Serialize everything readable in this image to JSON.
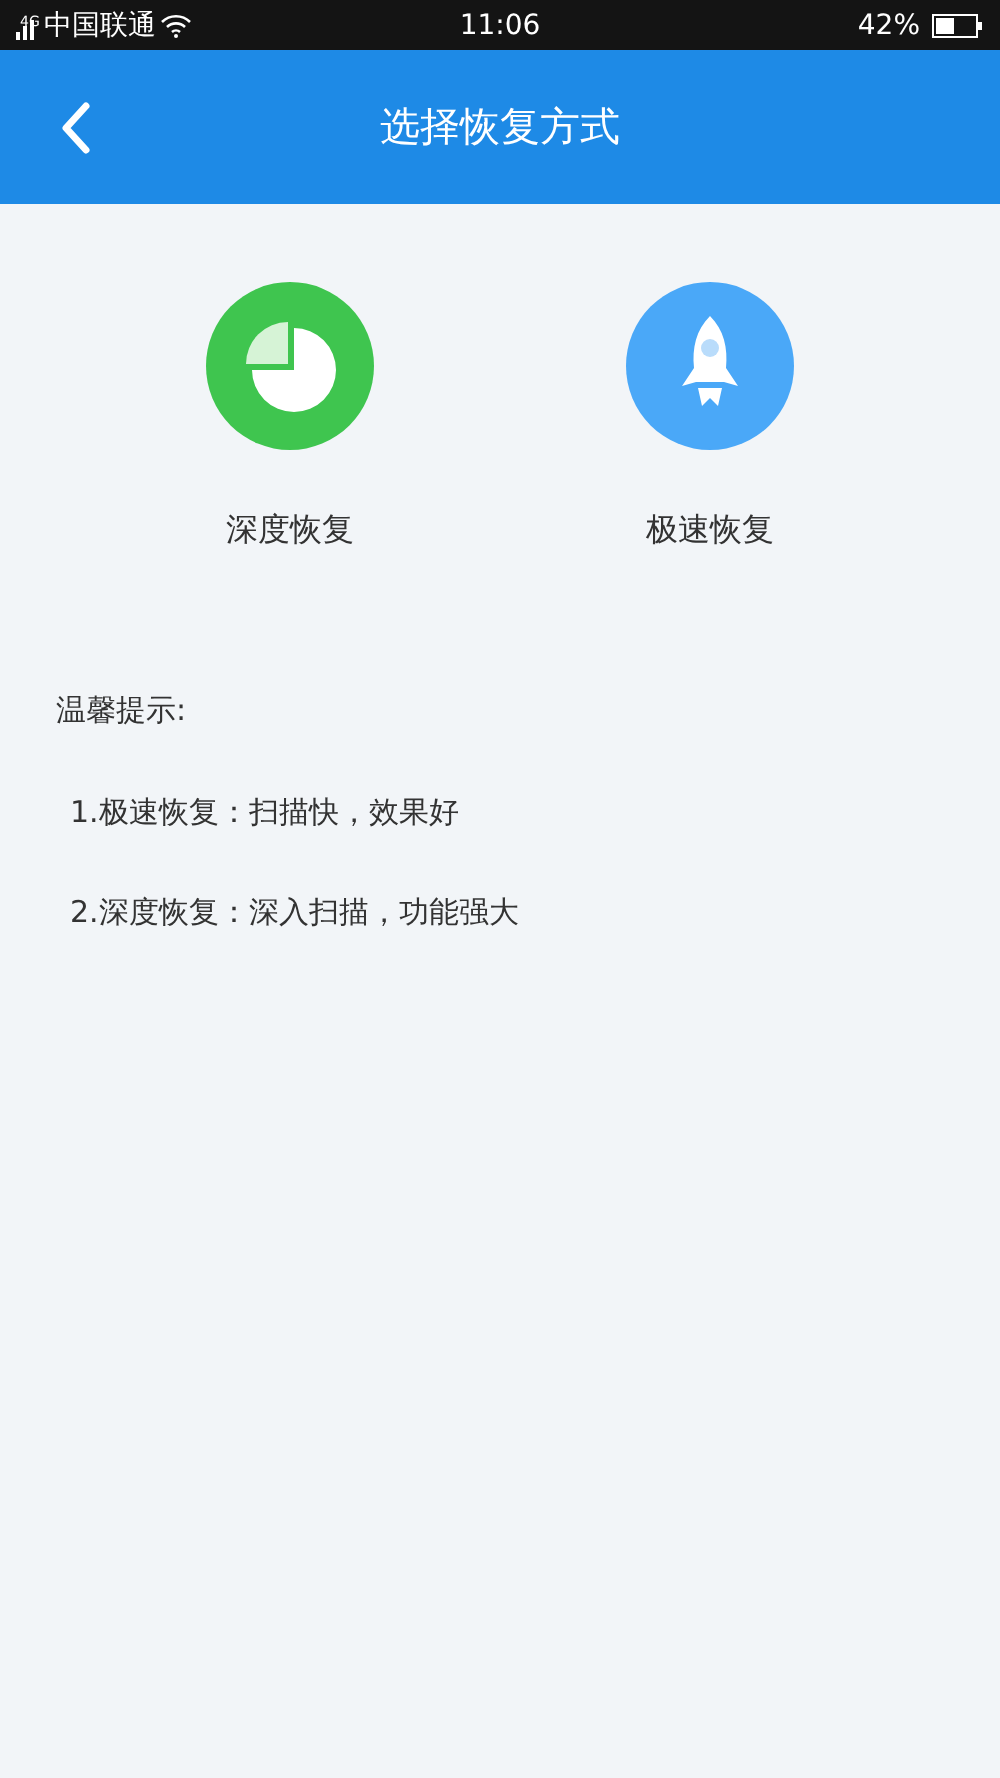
{
  "status_bar": {
    "network": "4G",
    "carrier": "中国联通",
    "time": "11:06",
    "battery": "42%"
  },
  "header": {
    "title": "选择恢复方式"
  },
  "options": [
    {
      "kind": "pie",
      "label": "深度恢复"
    },
    {
      "kind": "rocket",
      "label": "极速恢复"
    }
  ],
  "tips": {
    "title": "温馨提示:",
    "items": [
      "1.极速恢复：扫描快，效果好",
      "2.深度恢复：深入扫描，功能强大"
    ]
  }
}
